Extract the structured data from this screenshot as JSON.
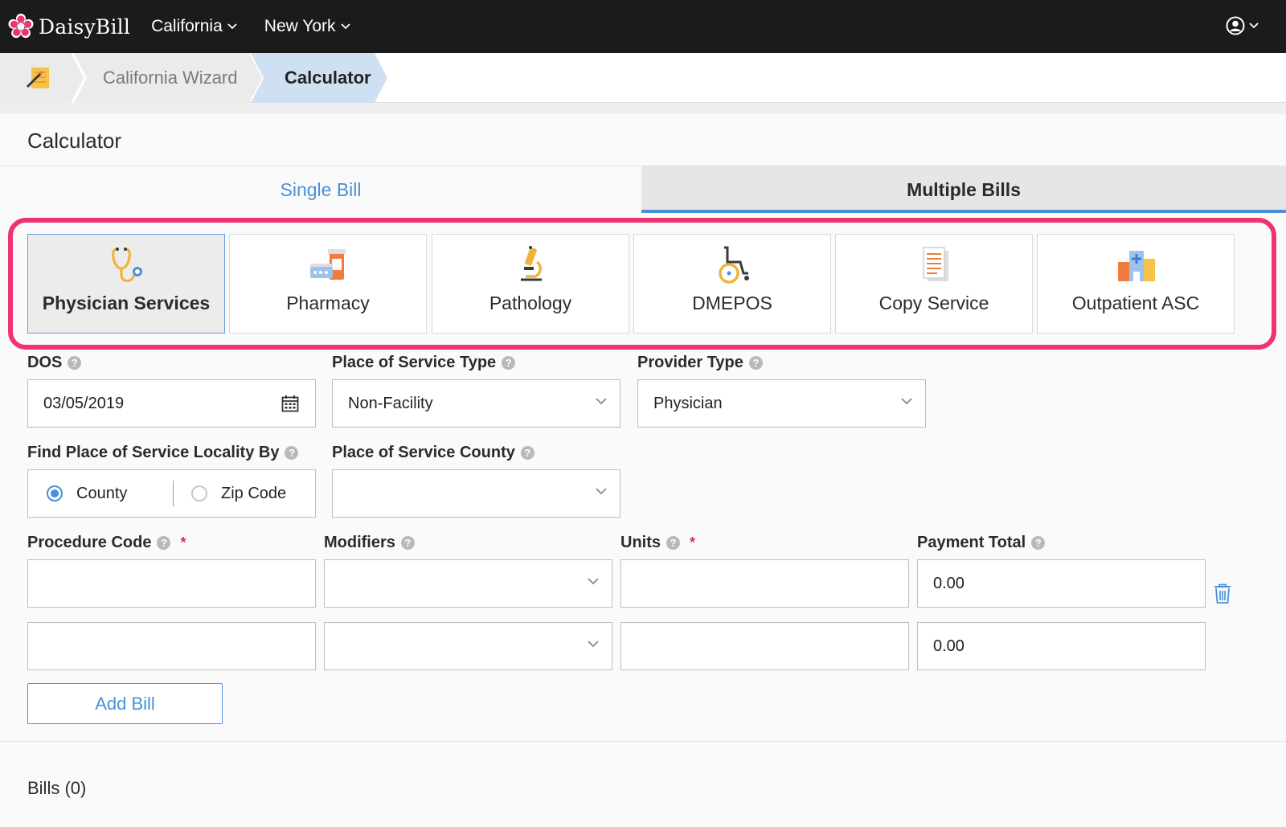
{
  "app": {
    "name": "DaisyBill",
    "brand_color": "#f0336f",
    "accent_color": "#4a90d9"
  },
  "nav": {
    "items": [
      {
        "label": "California",
        "icon": "chevron-down-icon"
      },
      {
        "label": "New York",
        "icon": "chevron-down-icon"
      }
    ],
    "user_icon": "user-circle-icon"
  },
  "breadcrumb": {
    "home_icon": "pencil-note-icon",
    "items": [
      {
        "label": "California Wizard"
      },
      {
        "label": "Calculator"
      }
    ]
  },
  "page": {
    "title": "Calculator"
  },
  "tabs": [
    {
      "label": "Single Bill"
    },
    {
      "label": "Multiple Bills"
    }
  ],
  "services": [
    {
      "label": "Physician Services",
      "icon": "stethoscope-icon",
      "selected": true
    },
    {
      "label": "Pharmacy",
      "icon": "pill-bottle-icon",
      "selected": false
    },
    {
      "label": "Pathology",
      "icon": "microscope-icon",
      "selected": false
    },
    {
      "label": "DMEPOS",
      "icon": "wheelchair-icon",
      "selected": false
    },
    {
      "label": "Copy Service",
      "icon": "document-copy-icon",
      "selected": false
    },
    {
      "label": "Outpatient ASC",
      "icon": "hospital-icon",
      "selected": false
    }
  ],
  "form": {
    "dos": {
      "label": "DOS",
      "value": "03/05/2019",
      "icon": "calendar-icon"
    },
    "place_of_service_type": {
      "label": "Place of Service Type",
      "value": "Non-Facility"
    },
    "provider_type": {
      "label": "Provider Type",
      "value": "Physician"
    },
    "find_locality": {
      "label": "Find Place of Service Locality By",
      "options": [
        {
          "label": "County",
          "selected": true
        },
        {
          "label": "Zip Code",
          "selected": false
        }
      ]
    },
    "county": {
      "label": "Place of Service County",
      "value": ""
    },
    "columns": {
      "procedure_code": "Procedure Code",
      "modifiers": "Modifiers",
      "units": "Units",
      "payment_total": "Payment Total",
      "required_mark": "*"
    },
    "rows": [
      {
        "procedure_code": "",
        "modifiers": "",
        "units": "",
        "payment_total": "0.00"
      },
      {
        "procedure_code": "",
        "modifiers": "",
        "units": "",
        "payment_total": "0.00"
      }
    ],
    "help_glyph": "?",
    "add_bill_label": "Add Bill"
  },
  "bills": {
    "label": "Bills (0)"
  }
}
